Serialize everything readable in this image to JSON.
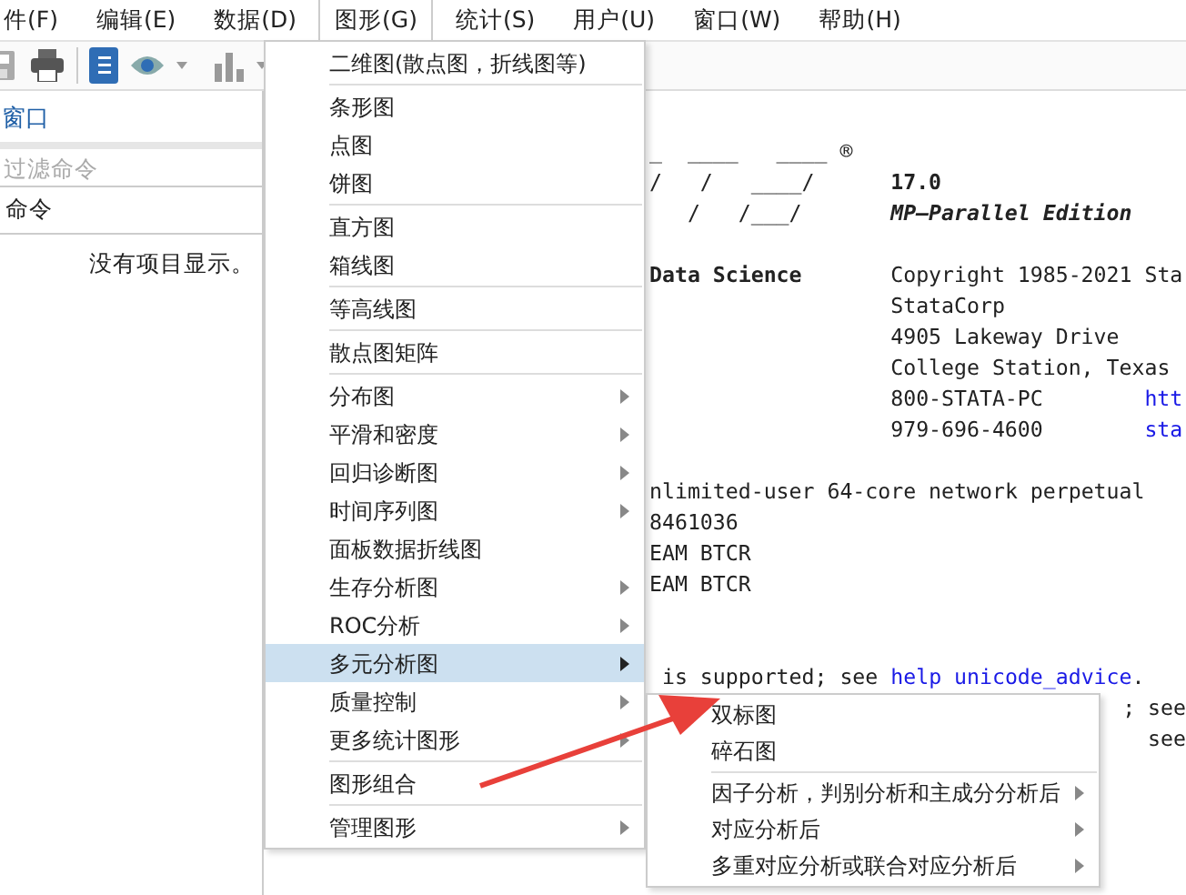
{
  "menubar": [
    {
      "label": "件(F)",
      "selected": false
    },
    {
      "label": "编辑(E)",
      "selected": false
    },
    {
      "label": "数据(D)",
      "selected": false
    },
    {
      "label": "图形(G)",
      "selected": true
    },
    {
      "label": "统计(S)",
      "selected": false
    },
    {
      "label": "用户(U)",
      "selected": false
    },
    {
      "label": "窗口(W)",
      "selected": false
    },
    {
      "label": "帮助(H)",
      "selected": false
    }
  ],
  "command_pane": {
    "title": "窗口",
    "filter": {
      "placeholder": "过滤命令"
    },
    "column": "命令",
    "empty_message": "没有项目显示。"
  },
  "results": [
    {
      "kind": "row",
      "left": [
        {
          "text": "_  ____   ____ ®",
          "kind": "plain"
        }
      ]
    },
    {
      "kind": "row",
      "left": [
        {
          "text": "/   /   ____/",
          "kind": "plain"
        }
      ],
      "middle": [
        {
          "text": "17.0",
          "kind": "bold"
        }
      ]
    },
    {
      "kind": "row",
      "left": [
        {
          "text": "   /   /___/",
          "kind": "plain"
        }
      ],
      "middle": [
        {
          "text": "MP—Parallel Edition",
          "kind": "bolditalic"
        }
      ]
    },
    {
      "kind": "blank"
    },
    {
      "kind": "row",
      "left": [
        {
          "text": "Data Science",
          "kind": "bold"
        }
      ],
      "middle": [
        {
          "text": "Copyright 1985-2021 Sta",
          "kind": "plain"
        }
      ]
    },
    {
      "kind": "row",
      "middle": [
        {
          "text": "StataCorp",
          "kind": "plain"
        }
      ]
    },
    {
      "kind": "row",
      "middle": [
        {
          "text": "4905 Lakeway Drive",
          "kind": "plain"
        }
      ]
    },
    {
      "kind": "row",
      "middle": [
        {
          "text": "College Station, Texas",
          "kind": "plain"
        }
      ]
    },
    {
      "kind": "row",
      "middle": [
        {
          "text": "800-STATA-PC",
          "kind": "plain"
        }
      ],
      "right": [
        {
          "text": "htt",
          "kind": "link"
        }
      ]
    },
    {
      "kind": "row",
      "middle": [
        {
          "text": "979-696-4600",
          "kind": "plain"
        }
      ],
      "right": [
        {
          "text": "sta",
          "kind": "link"
        }
      ]
    },
    {
      "kind": "blank"
    },
    {
      "kind": "row",
      "left": [
        {
          "text": "nlimited-user 64-core network perpetual",
          "kind": "plain"
        }
      ]
    },
    {
      "kind": "row",
      "left": [
        {
          "text": "8461036",
          "kind": "plain"
        }
      ]
    },
    {
      "kind": "row",
      "left": [
        {
          "text": "EAM BTCR",
          "kind": "plain"
        }
      ]
    },
    {
      "kind": "row",
      "left": [
        {
          "text": "EAM BTCR",
          "kind": "plain"
        }
      ]
    },
    {
      "kind": "blank"
    },
    {
      "kind": "blank"
    },
    {
      "kind": "row",
      "left": [
        {
          "text": " is supported; see ",
          "kind": "plain"
        },
        {
          "text": "help unicode_advice",
          "kind": "link"
        },
        {
          "text": ".",
          "kind": "plain"
        }
      ]
    },
    {
      "kind": "tail",
      "left": [
        {
          "text": "; see",
          "kind": "plain"
        }
      ]
    },
    {
      "kind": "tail",
      "left": [
        {
          "text": "see",
          "kind": "plain"
        }
      ]
    }
  ],
  "graphics_menu": [
    {
      "kind": "item",
      "label": "二维图(散点图，折线图等)",
      "submenu": false,
      "selected": false
    },
    {
      "kind": "separator"
    },
    {
      "kind": "item",
      "label": "条形图",
      "submenu": false,
      "selected": false
    },
    {
      "kind": "item",
      "label": "点图",
      "submenu": false,
      "selected": false
    },
    {
      "kind": "item",
      "label": "饼图",
      "submenu": false,
      "selected": false
    },
    {
      "kind": "separator"
    },
    {
      "kind": "item",
      "label": "直方图",
      "submenu": false,
      "selected": false
    },
    {
      "kind": "item",
      "label": "箱线图",
      "submenu": false,
      "selected": false
    },
    {
      "kind": "separator"
    },
    {
      "kind": "item",
      "label": "等高线图",
      "submenu": false,
      "selected": false
    },
    {
      "kind": "separator"
    },
    {
      "kind": "item",
      "label": "散点图矩阵",
      "submenu": false,
      "selected": false
    },
    {
      "kind": "separator"
    },
    {
      "kind": "item",
      "label": "分布图",
      "submenu": true,
      "selected": false
    },
    {
      "kind": "item",
      "label": "平滑和密度",
      "submenu": true,
      "selected": false
    },
    {
      "kind": "item",
      "label": "回归诊断图",
      "submenu": true,
      "selected": false
    },
    {
      "kind": "item",
      "label": "时间序列图",
      "submenu": true,
      "selected": false
    },
    {
      "kind": "item",
      "label": "面板数据折线图",
      "submenu": false,
      "selected": false
    },
    {
      "kind": "item",
      "label": "生存分析图",
      "submenu": true,
      "selected": false
    },
    {
      "kind": "item",
      "label": "ROC分析",
      "submenu": true,
      "selected": false
    },
    {
      "kind": "item",
      "label": "多元分析图",
      "submenu": true,
      "selected": true
    },
    {
      "kind": "item",
      "label": "质量控制",
      "submenu": true,
      "selected": false
    },
    {
      "kind": "item",
      "label": "更多统计图形",
      "submenu": true,
      "selected": false
    },
    {
      "kind": "separator"
    },
    {
      "kind": "item",
      "label": "图形组合",
      "submenu": false,
      "selected": false
    },
    {
      "kind": "separator"
    },
    {
      "kind": "item",
      "label": "管理图形",
      "submenu": true,
      "selected": false
    }
  ],
  "multivariate_submenu": [
    {
      "kind": "item",
      "label": "双标图",
      "submenu": false,
      "selected": false
    },
    {
      "kind": "item",
      "label": "碎石图",
      "submenu": false,
      "selected": false
    },
    {
      "kind": "separator"
    },
    {
      "kind": "item",
      "label": "因子分析，判别分析和主成分分析后",
      "submenu": true,
      "selected": false
    },
    {
      "kind": "item",
      "label": "对应分析后",
      "submenu": true,
      "selected": false
    },
    {
      "kind": "item",
      "label": "多重对应分析或联合对应分析后",
      "submenu": true,
      "selected": false
    }
  ]
}
